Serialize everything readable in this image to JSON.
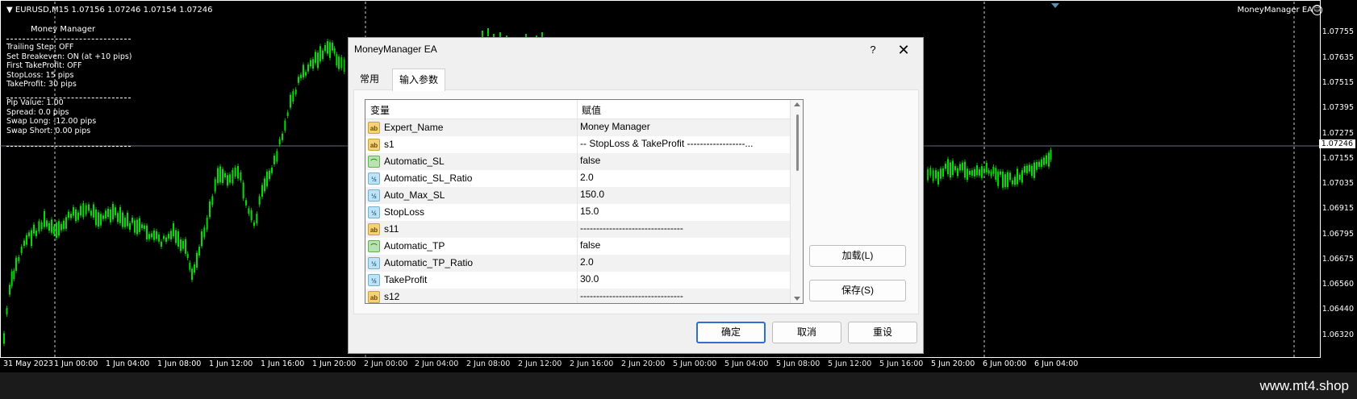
{
  "chart": {
    "symbol_info": "EURUSD,M15  1.07156 1.07246 1.07154 1.07246",
    "ea_label": "MoneyManager EA",
    "colors": {
      "candles": "#00e000",
      "background": "#000000",
      "grid": "#ffffff"
    }
  },
  "money_manager": {
    "title": "Money Manager",
    "lines_a": [
      "Trailing Step: OFF",
      "Set Breakeven: ON (at +10 pips)",
      "First TakeProfit: OFF",
      "StopLoss: 15 pips",
      "TakeProfit: 30 pips"
    ],
    "lines_b": [
      "Pip Value: 1.00",
      "Spread: 0.0 pips",
      "Swap Long: -12.00 pips",
      "Swap Short: 0.00 pips"
    ]
  },
  "price_scale": {
    "ticks": [
      "1.07755",
      "1.07635",
      "1.07515",
      "1.07395",
      "1.07275",
      "1.07155",
      "1.07035",
      "1.06915",
      "1.06795",
      "1.06675",
      "1.06560",
      "1.06440",
      "1.06320"
    ],
    "current": "1.07246"
  },
  "time_scale": {
    "ticks": [
      "31 May 2023",
      "1 Jun 00:00",
      "1 Jun 04:00",
      "1 Jun 08:00",
      "1 Jun 12:00",
      "1 Jun 16:00",
      "1 Jun 20:00",
      "2 Jun 00:00",
      "2 Jun 04:00",
      "2 Jun 08:00",
      "2 Jun 12:00",
      "2 Jun 16:00",
      "2 Jun 20:00",
      "5 Jun 00:00",
      "5 Jun 04:00",
      "5 Jun 08:00",
      "5 Jun 12:00",
      "5 Jun 16:00",
      "5 Jun 20:00",
      "6 Jun 00:00",
      "6 Jun 04:00"
    ]
  },
  "footer": {
    "site": "www.mt4.shop"
  },
  "dialog": {
    "title": "MoneyManager EA",
    "help": "?",
    "close": "✕",
    "tabs": {
      "common": "常用",
      "inputs": "输入参数"
    },
    "columns": {
      "variable": "变量",
      "value": "赋值"
    },
    "params": [
      {
        "icon": "ab",
        "type": "ab",
        "name": "Expert_Name",
        "value": "Money Manager"
      },
      {
        "icon": "ab",
        "type": "ab",
        "name": "s1",
        "value": "-- StopLoss & TakeProfit ------------------..."
      },
      {
        "icon": "⌒",
        "type": "bool",
        "name": "Automatic_SL",
        "value": "false"
      },
      {
        "icon": "½",
        "type": "num",
        "name": "Automatic_SL_Ratio",
        "value": "2.0"
      },
      {
        "icon": "½",
        "type": "num",
        "name": "Auto_Max_SL",
        "value": "150.0"
      },
      {
        "icon": "½",
        "type": "num",
        "name": "StopLoss",
        "value": "15.0"
      },
      {
        "icon": "ab",
        "type": "ab",
        "name": "s11",
        "value": "--------------------------------"
      },
      {
        "icon": "⌒",
        "type": "bool",
        "name": "Automatic_TP",
        "value": "false"
      },
      {
        "icon": "½",
        "type": "num",
        "name": "Automatic_TP_Ratio",
        "value": "2.0"
      },
      {
        "icon": "½",
        "type": "num",
        "name": "TakeProfit",
        "value": "30.0"
      },
      {
        "icon": "ab",
        "type": "ab",
        "name": "s12",
        "value": "--------------------------------"
      }
    ],
    "buttons": {
      "load": "加载(L)",
      "save": "保存(S)",
      "ok": "确定",
      "cancel": "取消",
      "reset": "重设"
    }
  }
}
